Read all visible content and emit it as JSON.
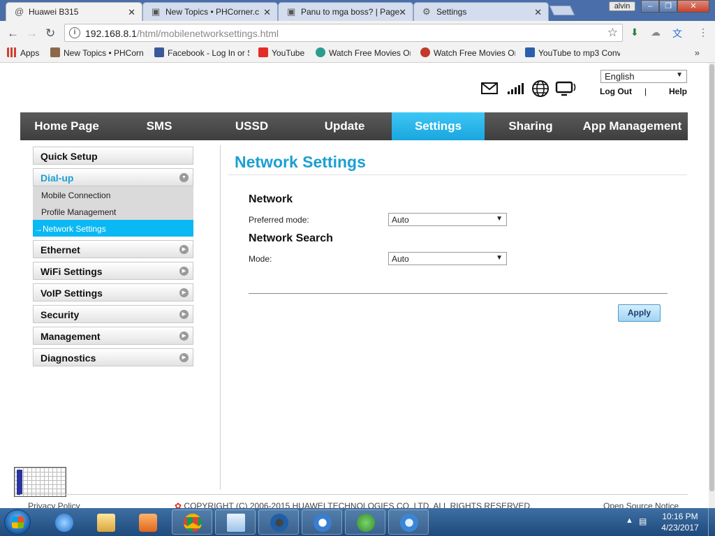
{
  "browser": {
    "tabs": [
      {
        "title": "Huawei B315",
        "icon": "at-icon",
        "active": true
      },
      {
        "title": "New Topics • PHCorner.c",
        "icon": "phcorner-icon",
        "active": false
      },
      {
        "title": "Panu to mga boss? | Page",
        "icon": "phcorner-icon",
        "active": false
      },
      {
        "title": "Settings",
        "icon": "gear-icon",
        "active": false
      }
    ],
    "user_badge": "alvin",
    "url_host": "192.168.8.1",
    "url_path": "/html/mobilenetworksettings.html",
    "bookmarks": [
      {
        "label": "Apps",
        "icon": "apps-grid-icon",
        "color": "#d04030"
      },
      {
        "label": "New Topics • PHCorn",
        "icon": "phcorner-icon",
        "color": "#8a6a4a"
      },
      {
        "label": "Facebook - Log In or S",
        "icon": "facebook-icon",
        "color": "#3b5998"
      },
      {
        "label": "YouTube",
        "icon": "youtube-icon",
        "color": "#e52d27"
      },
      {
        "label": "Watch Free Movies Or",
        "icon": "play-circle-icon",
        "color": "#2a9d8f"
      },
      {
        "label": "Watch Free Movies Or",
        "icon": "eye-icon",
        "color": "#c0392b"
      },
      {
        "label": "YouTube to mp3 Conv",
        "icon": "mp3-icon",
        "color": "#2b5fad"
      }
    ],
    "more_bookmarks": "»"
  },
  "router": {
    "language": "English",
    "logout": "Log Out",
    "divider": "|",
    "help": "Help",
    "nav": [
      "Home Page",
      "SMS",
      "USSD",
      "Update",
      "Settings",
      "Sharing",
      "App Management"
    ],
    "active_nav": "Settings",
    "side_menu": {
      "quick_setup": "Quick Setup",
      "dialup": "Dial-up",
      "dialup_items": [
        "Mobile Connection",
        "Profile Management",
        "→Network Settings"
      ],
      "others": [
        "Ethernet",
        "WiFi Settings",
        "VoIP Settings",
        "Security",
        "Management",
        "Diagnostics"
      ]
    },
    "page_title": "Network Settings",
    "network_heading": "Network",
    "preferred_mode_label": "Preferred mode:",
    "preferred_mode_value": "Auto",
    "search_heading": "Network Search",
    "mode_label": "Mode:",
    "mode_value": "Auto",
    "apply_label": "Apply",
    "footer_left": "Privacy Policy",
    "footer_center": "COPYRIGHT (C) 2006-2015 HUAWEI TECHNOLOGIES CO.,LTD. ALL RIGHTS RESERVED.",
    "footer_right": "Open Source Notice"
  },
  "taskbar": {
    "time": "10:16 PM",
    "date": "4/23/2017"
  },
  "colors": {
    "accent": "#1b9fd4",
    "nav_active": "#1aa6de",
    "nav_bg": "#4a4a4a"
  }
}
